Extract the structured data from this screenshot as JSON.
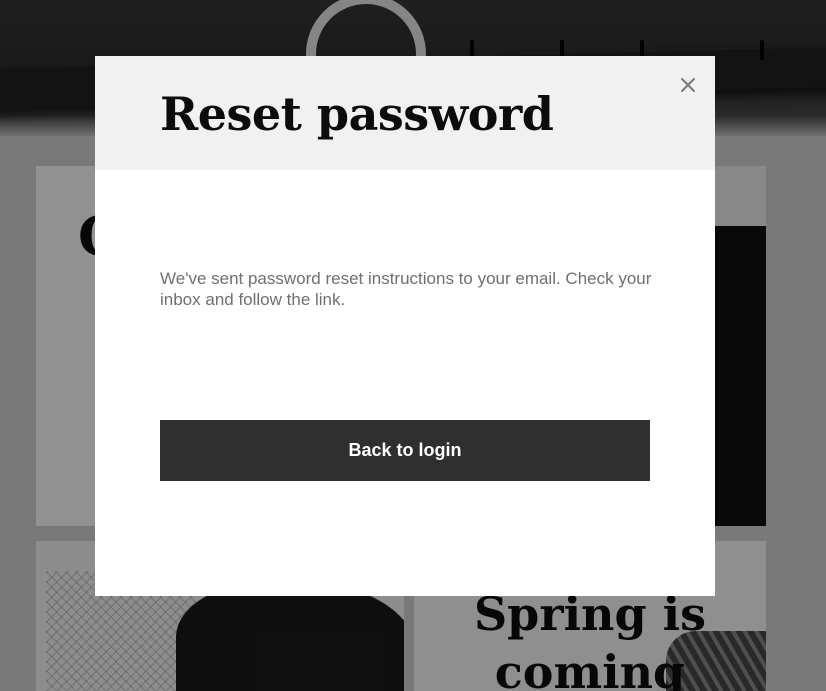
{
  "background": {
    "tile_top_left": {
      "title": "C"
    },
    "tile_bottom_right": {
      "title": "Spring is coming"
    }
  },
  "modal": {
    "title": "Reset password",
    "close_icon": "close-icon",
    "message": "We've sent password reset instructions to your email. Check your inbox and follow the link.",
    "primary_button_label": "Back to login"
  },
  "colors": {
    "header_bg": "#f1f1f1",
    "button_bg": "#2f2f2f",
    "button_text": "#ffffff",
    "message_text": "#6f6f6f"
  }
}
